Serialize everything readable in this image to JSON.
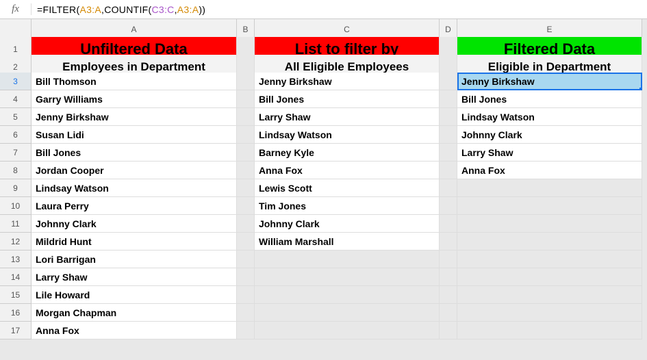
{
  "formula_bar": {
    "fx_label": "fx",
    "parts": {
      "p1": "=FILTER(",
      "r1": "A3:A",
      "p2": ",COUNTIF(",
      "r2": "C3:C",
      "p3": ",",
      "r3": "A3:A",
      "p4": "))"
    }
  },
  "columns": [
    "A",
    "B",
    "C",
    "D",
    "E"
  ],
  "rows": [
    "1",
    "2",
    "3",
    "4",
    "5",
    "6",
    "7",
    "8",
    "9",
    "10",
    "11",
    "12",
    "13",
    "14",
    "15",
    "16",
    "17"
  ],
  "headers": {
    "a1": "Unfiltered Data",
    "c1": "List to filter by",
    "e1": "Filtered Data",
    "a2": "Employees in Department",
    "c2": "All Eligible Employees",
    "e2": "Eligible in Department"
  },
  "col_a": [
    "Bill Thomson",
    "Garry Williams",
    "Jenny Birkshaw",
    "Susan Lidi",
    "Bill Jones",
    "Jordan Cooper",
    "Lindsay Watson",
    "Laura Perry",
    "Johnny Clark",
    "Mildrid Hunt",
    "Lori Barrigan",
    "Larry Shaw",
    "Lile Howard",
    "Morgan Chapman",
    "Anna Fox"
  ],
  "col_c": [
    "Jenny Birkshaw",
    "Bill Jones",
    "Larry Shaw",
    "Lindsay Watson",
    "Barney Kyle",
    "Anna Fox",
    "Lewis Scott",
    "Tim Jones",
    "Johnny Clark",
    "William Marshall"
  ],
  "col_e": [
    "Jenny Birkshaw",
    "Bill Jones",
    "Lindsay Watson",
    "Johnny Clark",
    "Larry Shaw",
    "Anna Fox"
  ],
  "selected_cell": "E3"
}
